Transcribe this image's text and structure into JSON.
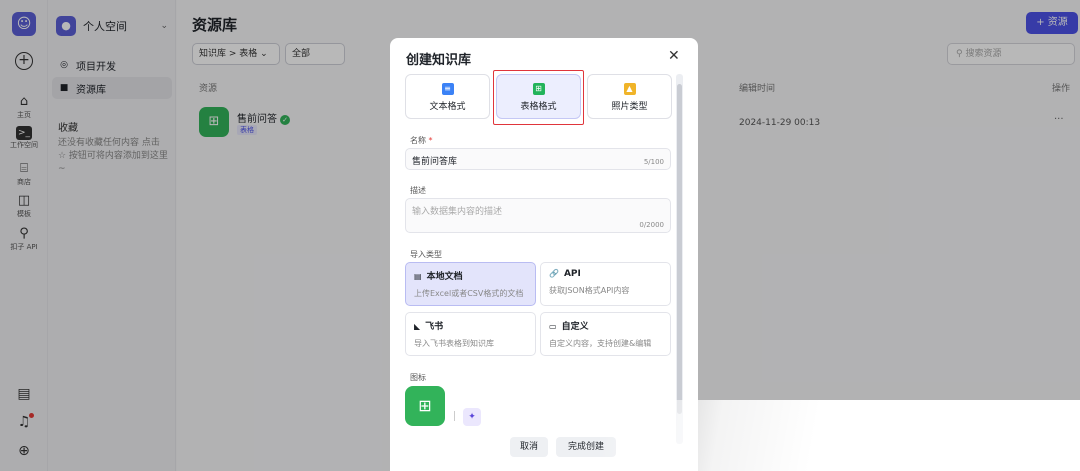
{
  "rail": {
    "items": [
      {
        "label": "主页",
        "icon": "home-icon"
      },
      {
        "label": "工作空间",
        "icon": "terminal-icon"
      },
      {
        "label": "商店",
        "icon": "store-icon"
      },
      {
        "label": "模板",
        "icon": "template-icon"
      },
      {
        "label": "扣子 API",
        "icon": "api-icon"
      }
    ]
  },
  "sidebar": {
    "space_name": "个人空间",
    "nav": [
      {
        "label": "项目开发"
      },
      {
        "label": "资源库"
      }
    ],
    "favorites_title": "收藏",
    "favorites_empty": "还没有收藏任何内容 点击 ☆ 按钮可将内容添加到这里~"
  },
  "main": {
    "title": "资源库",
    "add_button": "+ 资源",
    "filter_type": "知识库 > 表格",
    "filter_scope": "全部",
    "search_placeholder": "搜索资源",
    "columns": {
      "resource": "资源",
      "edit_time": "编辑时间",
      "actions": "操作"
    },
    "row": {
      "name": "售前问答",
      "tag": "表格",
      "edit_time": "2024-11-29 00:13",
      "more": "···"
    }
  },
  "modal": {
    "title": "创建知识库",
    "formats": [
      {
        "label": "文本格式",
        "color": "#3b82f6"
      },
      {
        "label": "表格格式",
        "color": "#22b35a"
      },
      {
        "label": "照片类型",
        "color": "#f0b429"
      }
    ],
    "name_label": "名称",
    "name_value": "售前问答库",
    "name_count": "5/100",
    "desc_label": "描述",
    "desc_placeholder": "输入数据集内容的描述",
    "desc_count": "0/2000",
    "import_label": "导入类型",
    "import_types": [
      {
        "title": "本地文档",
        "desc": "上传Excel或者CSV格式的文档"
      },
      {
        "title": "API",
        "desc": "获取JSON格式API内容"
      },
      {
        "title": "飞书",
        "desc": "导入飞书表格到知识库"
      },
      {
        "title": "自定义",
        "desc": "自定义内容，支持创建&编辑"
      }
    ],
    "icon_label": "图标",
    "cancel": "取消",
    "confirm": "完成创建"
  }
}
